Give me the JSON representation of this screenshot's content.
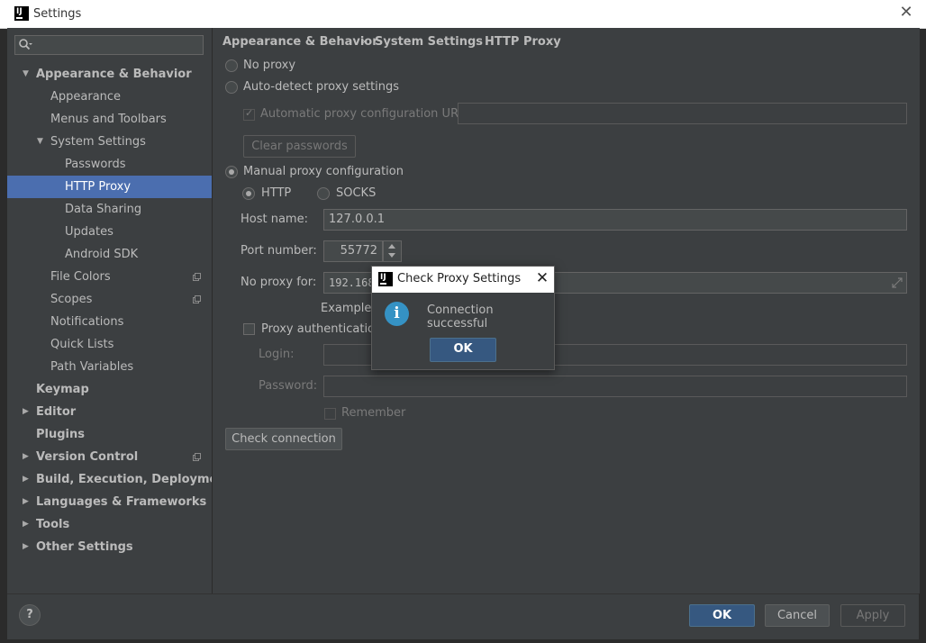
{
  "window": {
    "title": "Settings"
  },
  "sidebar": {
    "items": [
      {
        "label": "Appearance & Behavior",
        "level": 0,
        "bold": true,
        "arrow": "down"
      },
      {
        "label": "Appearance",
        "level": 1
      },
      {
        "label": "Menus and Toolbars",
        "level": 1
      },
      {
        "label": "System Settings",
        "level": 1,
        "arrow": "down"
      },
      {
        "label": "Passwords",
        "level": 2
      },
      {
        "label": "HTTP Proxy",
        "level": 2,
        "selected": true
      },
      {
        "label": "Data Sharing",
        "level": 2
      },
      {
        "label": "Updates",
        "level": 2
      },
      {
        "label": "Android SDK",
        "level": 2
      },
      {
        "label": "File Colors",
        "level": 1,
        "project": true
      },
      {
        "label": "Scopes",
        "level": 1,
        "project": true
      },
      {
        "label": "Notifications",
        "level": 1
      },
      {
        "label": "Quick Lists",
        "level": 1
      },
      {
        "label": "Path Variables",
        "level": 1
      },
      {
        "label": "Keymap",
        "level": 0,
        "bold": true
      },
      {
        "label": "Editor",
        "level": 0,
        "bold": true,
        "arrow": "right"
      },
      {
        "label": "Plugins",
        "level": 0,
        "bold": true
      },
      {
        "label": "Version Control",
        "level": 0,
        "bold": true,
        "arrow": "right",
        "project": true
      },
      {
        "label": "Build, Execution, Deployment",
        "level": 0,
        "bold": true,
        "arrow": "right"
      },
      {
        "label": "Languages & Frameworks",
        "level": 0,
        "bold": true,
        "arrow": "right"
      },
      {
        "label": "Tools",
        "level": 0,
        "bold": true,
        "arrow": "right"
      },
      {
        "label": "Other Settings",
        "level": 0,
        "bold": true,
        "arrow": "right"
      }
    ]
  },
  "breadcrumb": {
    "part1": "Appearance & Behavior",
    "part2": "System Settings",
    "part3": "HTTP Proxy",
    "sep": "›"
  },
  "proxy": {
    "no_proxy": "No proxy",
    "auto_detect": "Auto-detect proxy settings",
    "auto_url_label": "Automatic proxy configuration URL:",
    "auto_url_value": "",
    "clear_passwords": "Clear passwords",
    "manual": "Manual proxy configuration",
    "http": "HTTP",
    "socks": "SOCKS",
    "host_label": "Host name:",
    "host_value": "127.0.0.1",
    "port_label": "Port number:",
    "port_value": "55772",
    "noproxy_label": "No proxy for:",
    "noproxy_value": "192.168",
    "example_label": "Example:",
    "auth_label": "Proxy authentication",
    "login_label": "Login:",
    "login_value": "",
    "password_label": "Password:",
    "password_value": "",
    "remember_label": "Remember",
    "check_connection": "Check connection"
  },
  "footer": {
    "help": "?",
    "ok": "OK",
    "cancel": "Cancel",
    "apply": "Apply"
  },
  "dialog": {
    "title": "Check Proxy Settings",
    "message": "Connection successful",
    "ok": "OK",
    "icon": "info-icon"
  },
  "colors": {
    "selection": "#4b6eaf",
    "panel": "#3c3f41",
    "primary_button": "#365880",
    "info": "#3592c4"
  }
}
